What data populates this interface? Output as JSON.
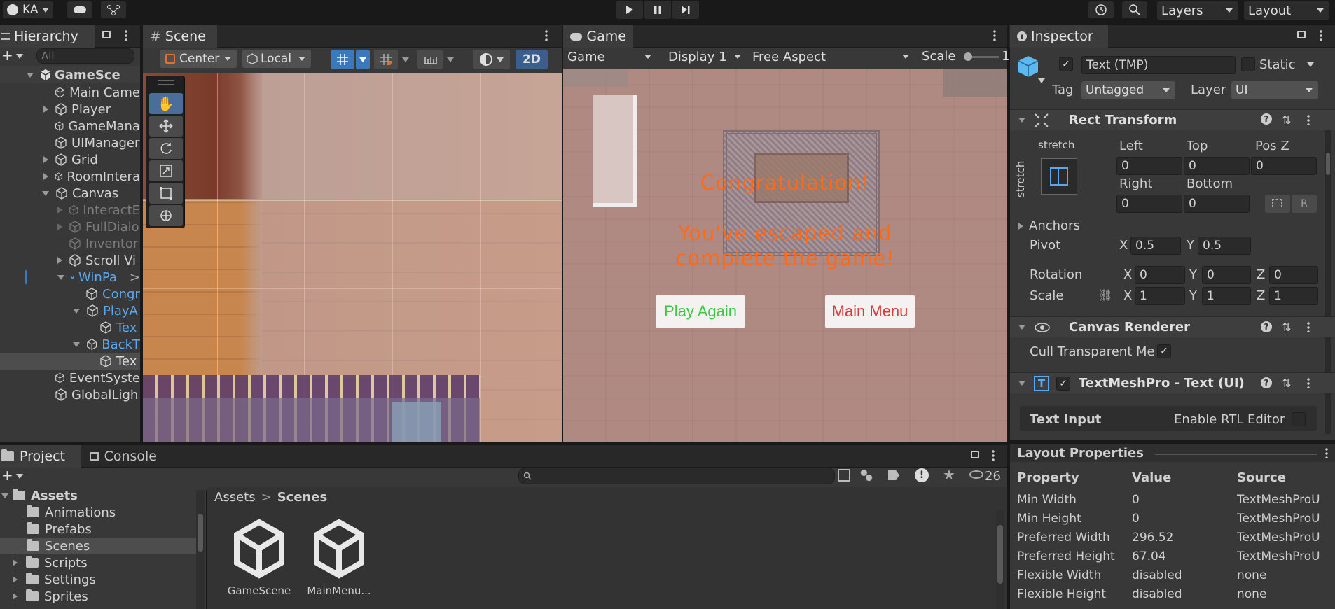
{
  "toolbar": {
    "account": "KA",
    "layers": "Layers",
    "layout": "Layout"
  },
  "hierarchy": {
    "tab": "Hierarchy",
    "search_placeholder": "All",
    "items": [
      {
        "label": "GameSce",
        "bold": true
      },
      {
        "label": "Main Came"
      },
      {
        "label": "Player"
      },
      {
        "label": "GameMana"
      },
      {
        "label": "UIManager"
      },
      {
        "label": "Grid"
      },
      {
        "label": "RoomIntera"
      },
      {
        "label": "Canvas"
      },
      {
        "label": "InteractE"
      },
      {
        "label": "FullDialo"
      },
      {
        "label": "Inventor"
      },
      {
        "label": "Scroll Vi"
      },
      {
        "label": "WinPa"
      },
      {
        "label": "Congr"
      },
      {
        "label": "PlayA"
      },
      {
        "label": "Tex"
      },
      {
        "label": "BackT"
      },
      {
        "label": "Tex"
      },
      {
        "label": "EventSyste"
      },
      {
        "label": "GlobalLigh"
      }
    ]
  },
  "scene": {
    "tab": "Scene",
    "pivot": "Center",
    "space": "Local",
    "mode2d": "2D"
  },
  "game": {
    "tab": "Game",
    "view": "Game",
    "display": "Display 1",
    "aspect": "Free Aspect",
    "scale_label": "Scale",
    "scale_value": "1",
    "title": "Congratulation!",
    "message_line1": "You've escaped and",
    "message_line2": "complete the game!",
    "play_again": "Play Again",
    "main_menu": "Main Menu"
  },
  "inspector": {
    "tab": "Inspector",
    "object_name": "Text (TMP)",
    "static_label": "Static",
    "tag_label": "Tag",
    "tag_value": "Untagged",
    "layer_label": "Layer",
    "layer_value": "UI",
    "rect_transform": "Rect Transform",
    "stretch_top": "stretch",
    "stretch_side": "stretch",
    "left_label": "Left",
    "top_label": "Top",
    "posz_label": "Pos Z",
    "left": "0",
    "top": "0",
    "posz": "0",
    "right_label": "Right",
    "bottom_label": "Bottom",
    "right": "0",
    "bottom": "0",
    "anchors": "Anchors",
    "pivot_label": "Pivot",
    "pivot_x": "0.5",
    "pivot_y": "0.5",
    "rotation_label": "Rotation",
    "rot_x": "0",
    "rot_y": "0",
    "rot_z": "0",
    "scale_label": "Scale",
    "scale_x": "1",
    "scale_y": "1",
    "scale_z": "1",
    "canvas_renderer": "Canvas Renderer",
    "cull_label": "Cull Transparent Me",
    "tmp_component": "TextMeshPro - Text (UI)",
    "text_input": "Text Input",
    "rtl": "Enable RTL Editor",
    "axis_x": "X",
    "axis_y": "Y",
    "axis_z": "Z",
    "r_btn": "R"
  },
  "layout_props": {
    "title": "Layout Properties",
    "headers": [
      "Property",
      "Value",
      "Source"
    ],
    "rows": [
      [
        "Min Width",
        "0",
        "TextMeshProU"
      ],
      [
        "Min Height",
        "0",
        "TextMeshProU"
      ],
      [
        "Preferred Width",
        "296.52",
        "TextMeshProU"
      ],
      [
        "Preferred Height",
        "67.04",
        "TextMeshProU"
      ],
      [
        "Flexible Width",
        "disabled",
        "none"
      ],
      [
        "Flexible Height",
        "disabled",
        "none"
      ]
    ]
  },
  "project": {
    "tab_project": "Project",
    "tab_console": "Console",
    "hidden_count": "26",
    "tree": [
      "Assets",
      "Animations",
      "Prefabs",
      "Scenes",
      "Scripts",
      "Settings",
      "Sprites"
    ],
    "breadcrumb_root": "Assets",
    "breadcrumb_current": "Scenes",
    "files": [
      "GameScene",
      "MainMenu..."
    ]
  },
  "colors": {
    "accent_blue": "#3a79bb",
    "game_text_orange": "#ff6a1a",
    "play_again_green": "#3cc846",
    "main_menu_red": "#d93a3a"
  }
}
